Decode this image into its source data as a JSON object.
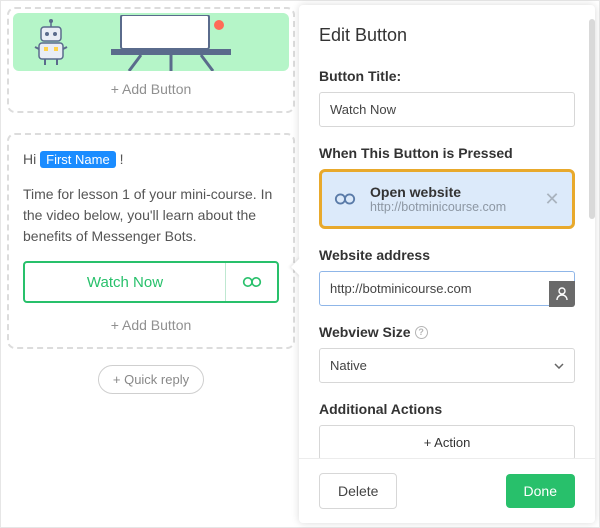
{
  "left": {
    "card_add_label": "+ Add Button",
    "msg": {
      "greeting_prefix": "Hi",
      "token": "First Name",
      "greeting_suffix": "!",
      "body": "Time for lesson 1 of your mini-course. In the video below, you'll learn about the benefits of Messenger Bots.",
      "watch_label": "Watch Now",
      "add_label": "+ Add Button"
    },
    "quick_reply_label": "+ Quick reply"
  },
  "panel": {
    "title": "Edit Button",
    "labels": {
      "button_title": "Button Title:",
      "when_pressed": "When This Button is Pressed",
      "website_address": "Website address",
      "webview_size": "Webview Size",
      "additional_actions": "Additional Actions"
    },
    "button_title_value": "Watch Now",
    "action": {
      "title": "Open website",
      "url": "http://botminicourse.com"
    },
    "website_address_value": "http://botminicourse.com",
    "webview_size_value": "Native",
    "add_action_label": "+ Action",
    "footer": {
      "delete": "Delete",
      "done": "Done"
    }
  }
}
